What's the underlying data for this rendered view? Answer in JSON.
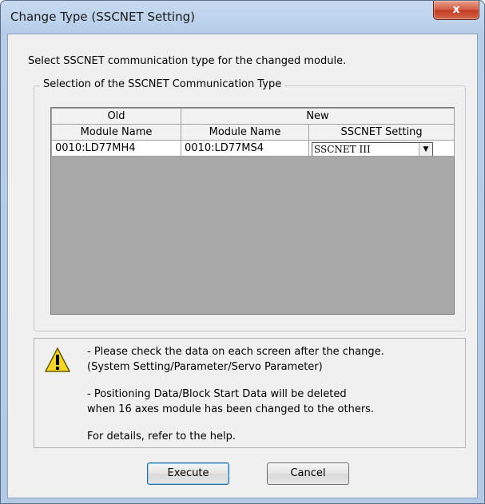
{
  "window": {
    "title": "Change Type (SSCNET Setting)",
    "close_label": "x"
  },
  "dialog": {
    "instruction": "Select SSCNET communication type for the changed module.",
    "group_label": "Selection of the SSCNET Communication Type"
  },
  "table": {
    "group_headers": [
      "Old",
      "New"
    ],
    "column_headers": [
      "Module Name",
      "Module Name",
      "SSCNET Setting"
    ],
    "rows": [
      {
        "old_module": "0010:LD77MH4",
        "new_module": "0010:LD77MS4",
        "sscnet_setting": "SSCNET III"
      }
    ]
  },
  "notice": {
    "icon": "warning-icon",
    "lines": [
      "- Please check the data on each screen after the change.",
      "(System Setting/Parameter/Servo Parameter)",
      "- Positioning Data/Block Start Data will be deleted",
      "when 16 axes module has been changed to the others.",
      "For details, refer to the help."
    ]
  },
  "buttons": {
    "execute": "Execute",
    "cancel": "Cancel"
  },
  "colors": {
    "title_bar": "#c7daf0",
    "close_button": "#c94a2f",
    "grid_empty": "#a8a8a8",
    "warning_yellow": "#f6d62b"
  }
}
